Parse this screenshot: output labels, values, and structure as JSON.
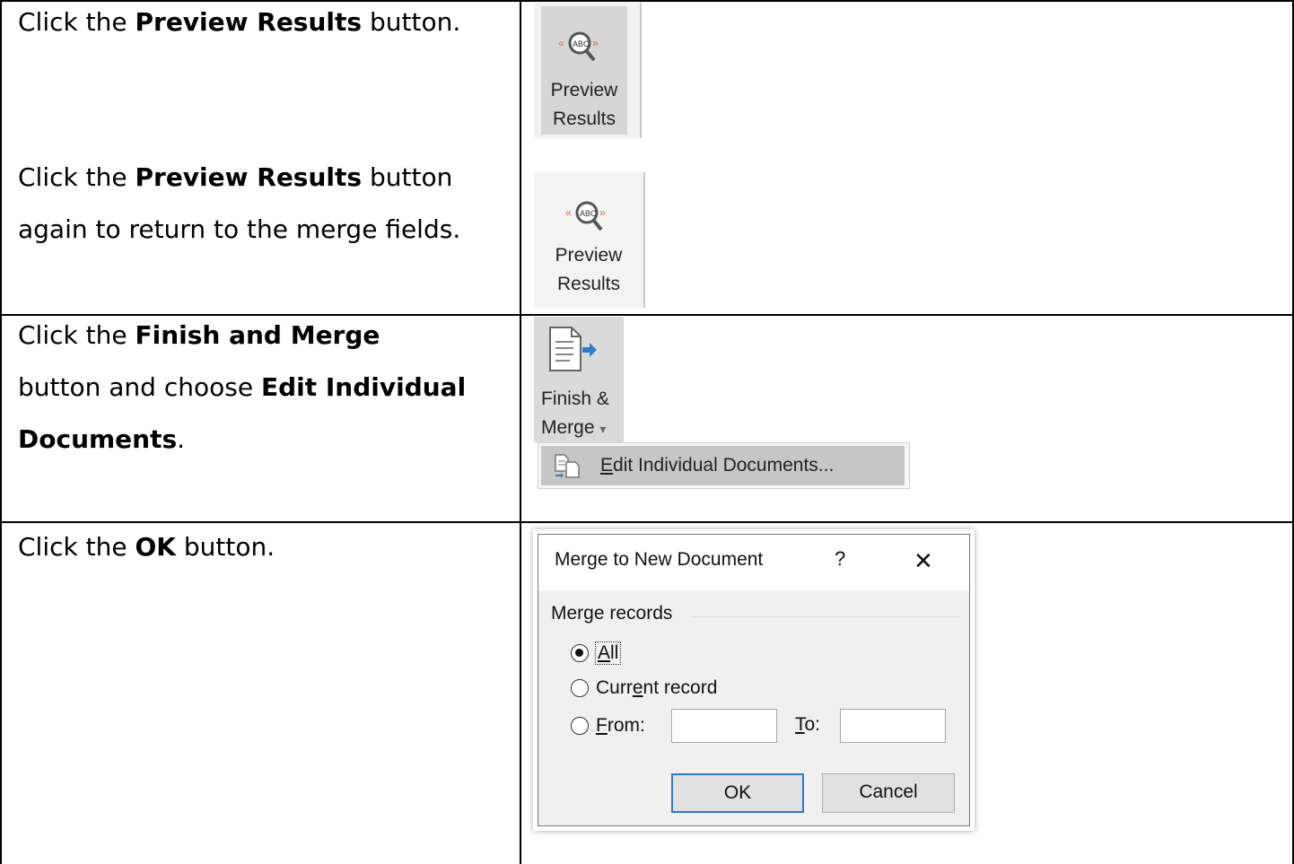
{
  "rows": [
    {
      "instruction": {
        "pre": "Click the ",
        "bold": "Preview Results",
        "post": " button."
      },
      "image": {
        "label_line1": "Preview",
        "label_line2": "Results",
        "state": "pressed"
      }
    },
    {
      "instruction": {
        "pre": "Click the ",
        "bold": "Preview Results",
        "post": " button again to return to the merge fields."
      },
      "image": {
        "label_line1": "Preview",
        "label_line2": "Results",
        "state": "normal"
      }
    },
    {
      "instruction": {
        "pre": "Click the ",
        "bold": "Finish and Merge",
        "mid": " button and choose ",
        "bold2": "Edit Individual Documents",
        "post": "."
      },
      "image": {
        "label_line1": "Finish &",
        "label_line2": "Merge",
        "dropdown_arrow": "▾",
        "menu_item": "Edit Individual Documents...",
        "menu_item_accel": "E"
      }
    },
    {
      "instruction": {
        "pre": "Click the ",
        "bold": "OK",
        "post": " button."
      },
      "dialog": {
        "title": "Merge to New Document",
        "help": "?",
        "close": "✕",
        "group_label": "Merge records",
        "radio_all": "All",
        "radio_current": "Current record",
        "radio_from": "From:",
        "to_label": "To:",
        "selected": "All",
        "ok_label": "OK",
        "cancel_label": "Cancel"
      }
    }
  ],
  "icons": {
    "preview": "preview-results-icon",
    "finish": "finish-merge-icon",
    "edit_docs": "edit-documents-icon"
  },
  "colors": {
    "preview_accent": "#e8643c",
    "arrow": "#2e7bd1"
  }
}
